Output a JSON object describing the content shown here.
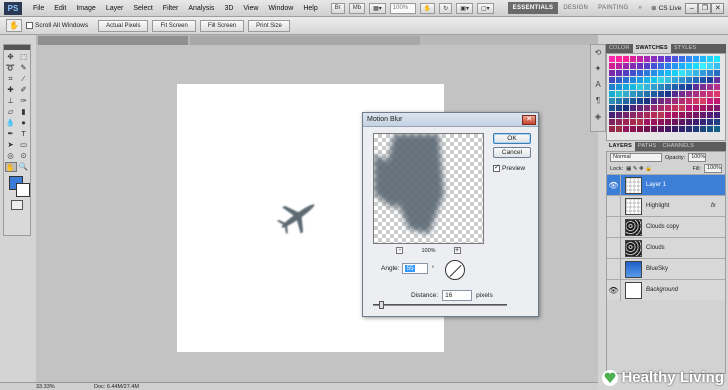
{
  "app": {
    "logo": "PS"
  },
  "menubar": {
    "items": [
      "File",
      "Edit",
      "Image",
      "Layer",
      "Select",
      "Filter",
      "Analysis",
      "3D",
      "View",
      "Window",
      "Help"
    ],
    "zoom_value": "100%",
    "workspaces": [
      "ESSENTIALS",
      "DESIGN",
      "PAINTING"
    ],
    "more": "»",
    "cs_live": "CS Live"
  },
  "optionsbar": {
    "scroll_all_windows": "Scroll All Windows",
    "buttons": [
      "Actual Pixels",
      "Fit Screen",
      "Fill Screen",
      "Print Size"
    ]
  },
  "motion_blur": {
    "title": "Motion Blur",
    "ok": "OK",
    "cancel": "Cancel",
    "preview": "Preview",
    "zoom_pct": "100%",
    "angle_label": "Angle:",
    "angle_value": "55",
    "angle_unit": "°",
    "distance_label": "Distance:",
    "distance_value": "16",
    "distance_unit": "pixels"
  },
  "panels": {
    "top_tabs": [
      "COLOR",
      "SWATCHES",
      "STYLES"
    ],
    "layer_tabs": [
      "LAYERS",
      "PATHS",
      "CHANNELS"
    ],
    "blend_mode": "Normal",
    "opacity_label": "Opacity:",
    "opacity_value": "100%",
    "lock_label": "Lock:",
    "fill_label": "Fill:",
    "fill_value": "100%",
    "layers": [
      {
        "name": "Layer 1",
        "active": true,
        "fx": "",
        "thumb": "checker"
      },
      {
        "name": "Highlight",
        "active": false,
        "fx": "fx",
        "thumb": "checker"
      },
      {
        "name": "Clouds copy",
        "active": false,
        "fx": "",
        "thumb": "noise"
      },
      {
        "name": "Clouds",
        "active": false,
        "fx": "",
        "thumb": "noise"
      },
      {
        "name": "BlueSky",
        "active": false,
        "fx": "",
        "thumb": "blue"
      },
      {
        "name": "Background",
        "active": false,
        "fx": "",
        "thumb": "white"
      }
    ],
    "swatch_colors": [
      "#e21e8a",
      "#d81b7d",
      "#c6197a",
      "#b01a7a",
      "#9b1b85",
      "#84208e",
      "#6d2597",
      "#5a2aa0",
      "#4a35a8",
      "#3b45b2",
      "#2f58bb",
      "#276bc3",
      "#1f7fcb",
      "#1993d3",
      "#16a6d8",
      "#15b8db",
      "#2ec9d8",
      "#35b4d2",
      "#2f9fca",
      "#2a8ac0",
      "#2675b5",
      "#2260aa",
      "#1f4c9e",
      "#1b3a93",
      "#5b2e96",
      "#7a2f91",
      "#96308c",
      "#b13187",
      "#c93280",
      "#dc3579",
      "#e83a72",
      "#ef466e"
    ],
    "swatch_footer": "#6a7c8e"
  },
  "status": {
    "zoom": "33.33%",
    "doc": "Doc: 6.44M/27.4M"
  },
  "watermark": {
    "text": "Healthy Living"
  }
}
